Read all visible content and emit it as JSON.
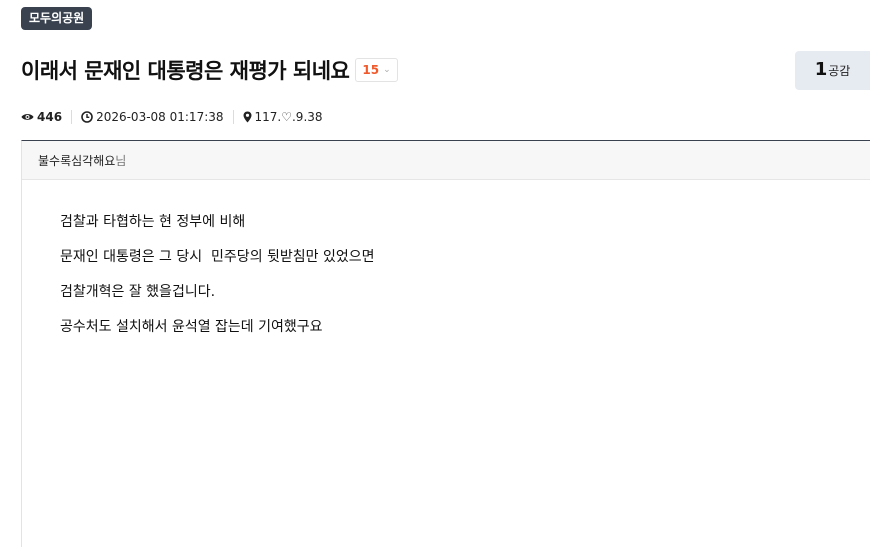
{
  "board": {
    "name": "모두의공원"
  },
  "post": {
    "title": "이래서 문재인 대통령은 재평가 되네요",
    "comment_count": "15",
    "likes": {
      "count": "1",
      "label": "공감"
    },
    "meta": {
      "views": "446",
      "datetime": "2026-03-08 01:17:38",
      "ip": "117.♡.9.38"
    },
    "author": {
      "name": "불수록심각해요",
      "suffix": "님"
    },
    "body_lines": [
      "검찰과 타협하는 현 정부에 비해",
      "문재인 대통령은 그 당시  민주당의 뒷받침만 있었으면",
      "검찰개혁은 잘 했을겁니다.",
      "공수처도 설치해서 윤석열 잡는데 기여했구요"
    ]
  },
  "colors": {
    "badge_bg": "#3a4250",
    "comment_count": "#ef5b2d",
    "like_bg": "#e6ebf1"
  },
  "icons": {
    "views": "eye-icon",
    "time": "clock-icon",
    "ip": "location-pin-icon",
    "comment_toggle": "chevron-down-icon"
  }
}
